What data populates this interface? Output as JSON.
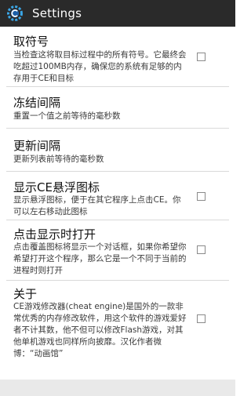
{
  "app": {
    "title": "Settings",
    "icon": "cheat-engine-gear-icon"
  },
  "preferences": [
    {
      "title": "取符号",
      "summary": "当检查这将取目标过程中的所有符号。它最终会吃超过100MB内存，确保您的系统有足够的内存用于CE和目标",
      "checkbox": true,
      "checked": false
    },
    {
      "title": "冻结间隔",
      "summary": "重置一个值之前等待的毫秒数",
      "checkbox": false
    },
    {
      "title": "更新间隔",
      "summary": "更新列表前等待的毫秒数",
      "checkbox": false
    },
    {
      "title": "显示CE悬浮图标",
      "summary": "显示悬浮图标，便于在其它程序上点击CE。你可以左右移动此图标",
      "checkbox": true,
      "checked": false
    },
    {
      "title": "点击显示时打开",
      "summary": "点击覆盖图标将显示一个对话框，如果你希望你希望打开这个程序，那么它是一个不同于当前的进程时则打开",
      "checkbox": true,
      "checked": false
    },
    {
      "title": "关于",
      "summary": "CE游戏修改器(cheat engine)是国外的一款非常优秀的内存修改软件，用这个软件的游戏爱好者不计其数，他不但可以修改Flash游戏，对其他单机游戏也同样所向披靡。汉化作者微博：“动画馆”",
      "checkbox": true,
      "checked": false
    }
  ],
  "colors": {
    "action_bar": "#2a2a2a",
    "title_text": "#ffffff",
    "pref_title": "#111111",
    "pref_summary": "#3a3a3a",
    "divider": "#d9d9d9",
    "bottom_bar": "#e9e9e9"
  }
}
